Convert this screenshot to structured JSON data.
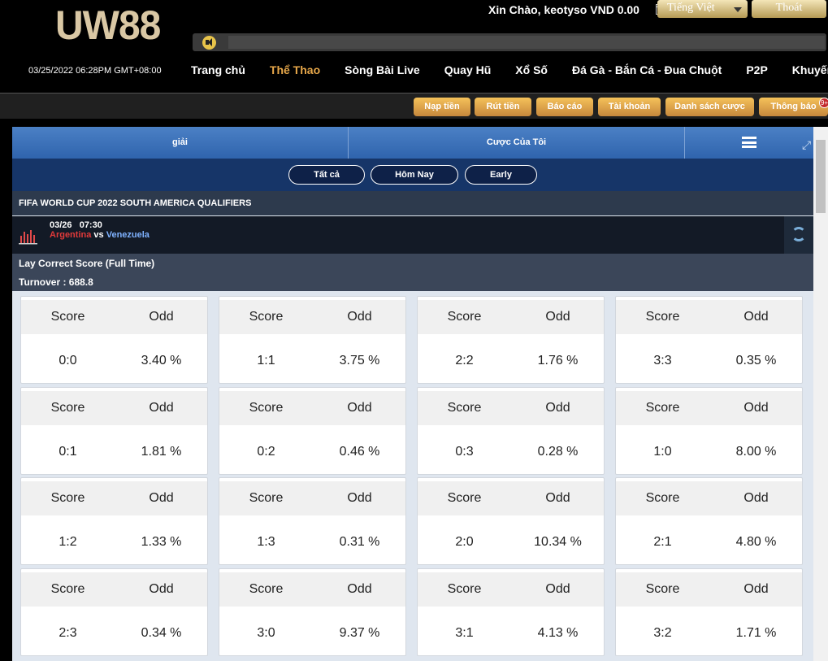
{
  "header": {
    "logo": "UW88",
    "greeting": "Xin Chào, keotyso VND 0.00",
    "language": "Tiếng Việt",
    "logout": "Thoát",
    "datetime": "03/25/2022 06:28PM GMT+08:00",
    "nav": [
      "Trang chủ",
      "Thể Thao",
      "Sòng Bài Live",
      "Quay Hũ",
      "Xổ Số",
      "Đá Gà - Bắn Cá - Đua Chuột",
      "P2P",
      "Khuyến mại"
    ]
  },
  "subbar": {
    "buttons": [
      "Nạp tiền",
      "Rút tiền",
      "Báo cáo",
      "Tài khoản",
      "Danh sách cược",
      "Thông báo"
    ],
    "badge": "9+"
  },
  "panel": {
    "tab_left": "giải",
    "tab_mid": "Cược Của Tôi",
    "filters": [
      "Tất cả",
      "Hôm Nay",
      "Early"
    ],
    "league": "FIFA WORLD CUP 2022 SOUTH AMERICA QUALIFIERS",
    "match": {
      "datetime": "03/26   07:30",
      "home": "Argentina",
      "vs": "vs",
      "away": "Venezuela"
    },
    "bet_type": "Lay Correct Score (Full Time)",
    "turnover": "Turnover : 688.8"
  },
  "grid": {
    "score_header": "Score",
    "odd_header": "Odd",
    "cards": [
      {
        "score": "0:0",
        "odd": "3.40 %"
      },
      {
        "score": "1:1",
        "odd": "3.75 %"
      },
      {
        "score": "2:2",
        "odd": "1.76 %"
      },
      {
        "score": "3:3",
        "odd": "0.35 %"
      },
      {
        "score": "0:1",
        "odd": "1.81 %"
      },
      {
        "score": "0:2",
        "odd": "0.46 %"
      },
      {
        "score": "0:3",
        "odd": "0.28 %"
      },
      {
        "score": "1:0",
        "odd": "8.00 %"
      },
      {
        "score": "1:2",
        "odd": "1.33 %"
      },
      {
        "score": "1:3",
        "odd": "0.31 %"
      },
      {
        "score": "2:0",
        "odd": "10.34 %"
      },
      {
        "score": "2:1",
        "odd": "4.80 %"
      },
      {
        "score": "2:3",
        "odd": "0.34 %"
      },
      {
        "score": "3:0",
        "odd": "9.37 %"
      },
      {
        "score": "3:1",
        "odd": "4.13 %"
      },
      {
        "score": "3:2",
        "odd": "1.71 %"
      }
    ]
  }
}
